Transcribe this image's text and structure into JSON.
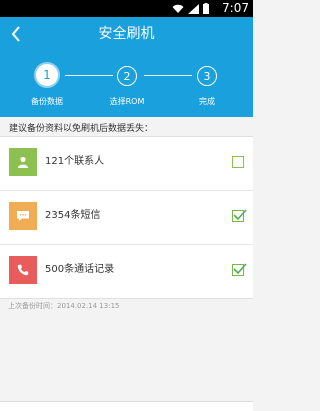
{
  "status_bar": {
    "time": "7:07"
  },
  "header": {
    "title": "安全刷机"
  },
  "steps": [
    {
      "number": "1",
      "label": "备份数据"
    },
    {
      "number": "2",
      "label": "选择ROM"
    },
    {
      "number": "3",
      "label": "完成"
    }
  ],
  "prompt": "建议备份资料以免刷机后数据丢失：",
  "items": [
    {
      "label": "121个联系人",
      "icon": "contact-icon",
      "color": "#8cc152",
      "checked": false
    },
    {
      "label": "2354条短信",
      "icon": "message-icon",
      "color": "#f0ad55",
      "checked": true
    },
    {
      "label": "500条通话记录",
      "icon": "phone-icon",
      "color": "#e85c5c",
      "checked": true
    }
  ],
  "last_backup": "上次备份时间：2014.02.14  13:15",
  "colors": {
    "header": "#1aa0dc",
    "check": "#4caf50"
  }
}
